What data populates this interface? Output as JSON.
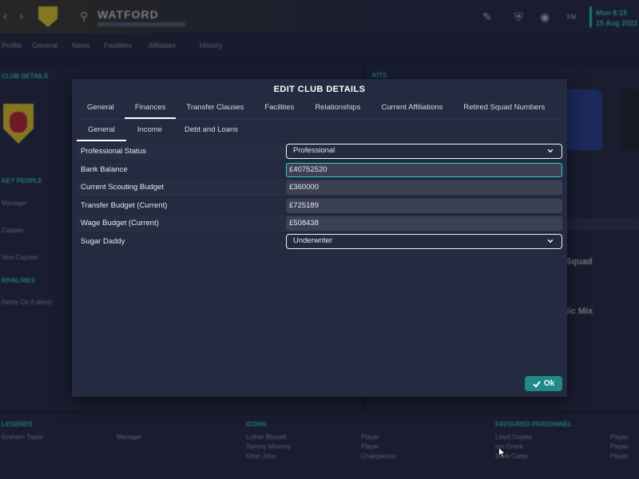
{
  "background": {
    "club_name": "WATFORD",
    "date_line1": "Mon 8:15",
    "date_line2": "15 Aug 2022",
    "nav": [
      "Profile",
      "General",
      "News",
      "Facilities",
      "Affiliates",
      "History"
    ],
    "left_labels": [
      "CLUB DETAILS",
      "KEY PEOPLE",
      "RIVALRIES"
    ],
    "left_people": [
      "Manager",
      "Captain",
      "Vice Captain"
    ],
    "rival": "Derby Co (Latest)",
    "kits_label": "KITS",
    "legends_label": "LEGENDS",
    "legend_name": "Graham Taylor",
    "legend_role": "Manager",
    "icons_label": "ICONS",
    "icons": [
      "Luther Blissett",
      "Tommy Mooney",
      "Elton John"
    ],
    "icon_roles": [
      "Player",
      "Player",
      "Chairperson"
    ],
    "fav_label": "FAVOURED PERSONNEL",
    "fav": [
      "Lloyd Doyley",
      "Ian Grierk",
      "Mark Catan"
    ],
    "fav_roles": [
      "Player",
      "Player",
      "Player"
    ],
    "right_snippets": [
      "Squad",
      "tic Mix"
    ]
  },
  "modal": {
    "title": "EDIT CLUB DETAILS",
    "tabs": [
      "General",
      "Finances",
      "Transfer Clauses",
      "Facilities",
      "Relationships",
      "Current Affiliations",
      "Retired Squad Numbers"
    ],
    "active_tab": "Finances",
    "subtabs": [
      "General",
      "Income",
      "Debt and Loans"
    ],
    "active_subtab": "General",
    "rows": [
      {
        "label": "Professional Status",
        "type": "select",
        "value": "Professional"
      },
      {
        "label": "Bank Balance",
        "type": "input",
        "value": "£40752520"
      },
      {
        "label": "Current Scouting Budget",
        "type": "input",
        "value": "£360000"
      },
      {
        "label": "Transfer Budget (Current)",
        "type": "input",
        "value": "£725189"
      },
      {
        "label": "Wage Budget (Current)",
        "type": "input",
        "value": "£508438"
      },
      {
        "label": "Sugar Daddy",
        "type": "select",
        "value": "Underwriter"
      }
    ],
    "ok_label": "Ok"
  },
  "colors": {
    "accent": "#2ad1c9",
    "ok_button": "#1f8a86",
    "modal_bg": "#242a3f"
  }
}
